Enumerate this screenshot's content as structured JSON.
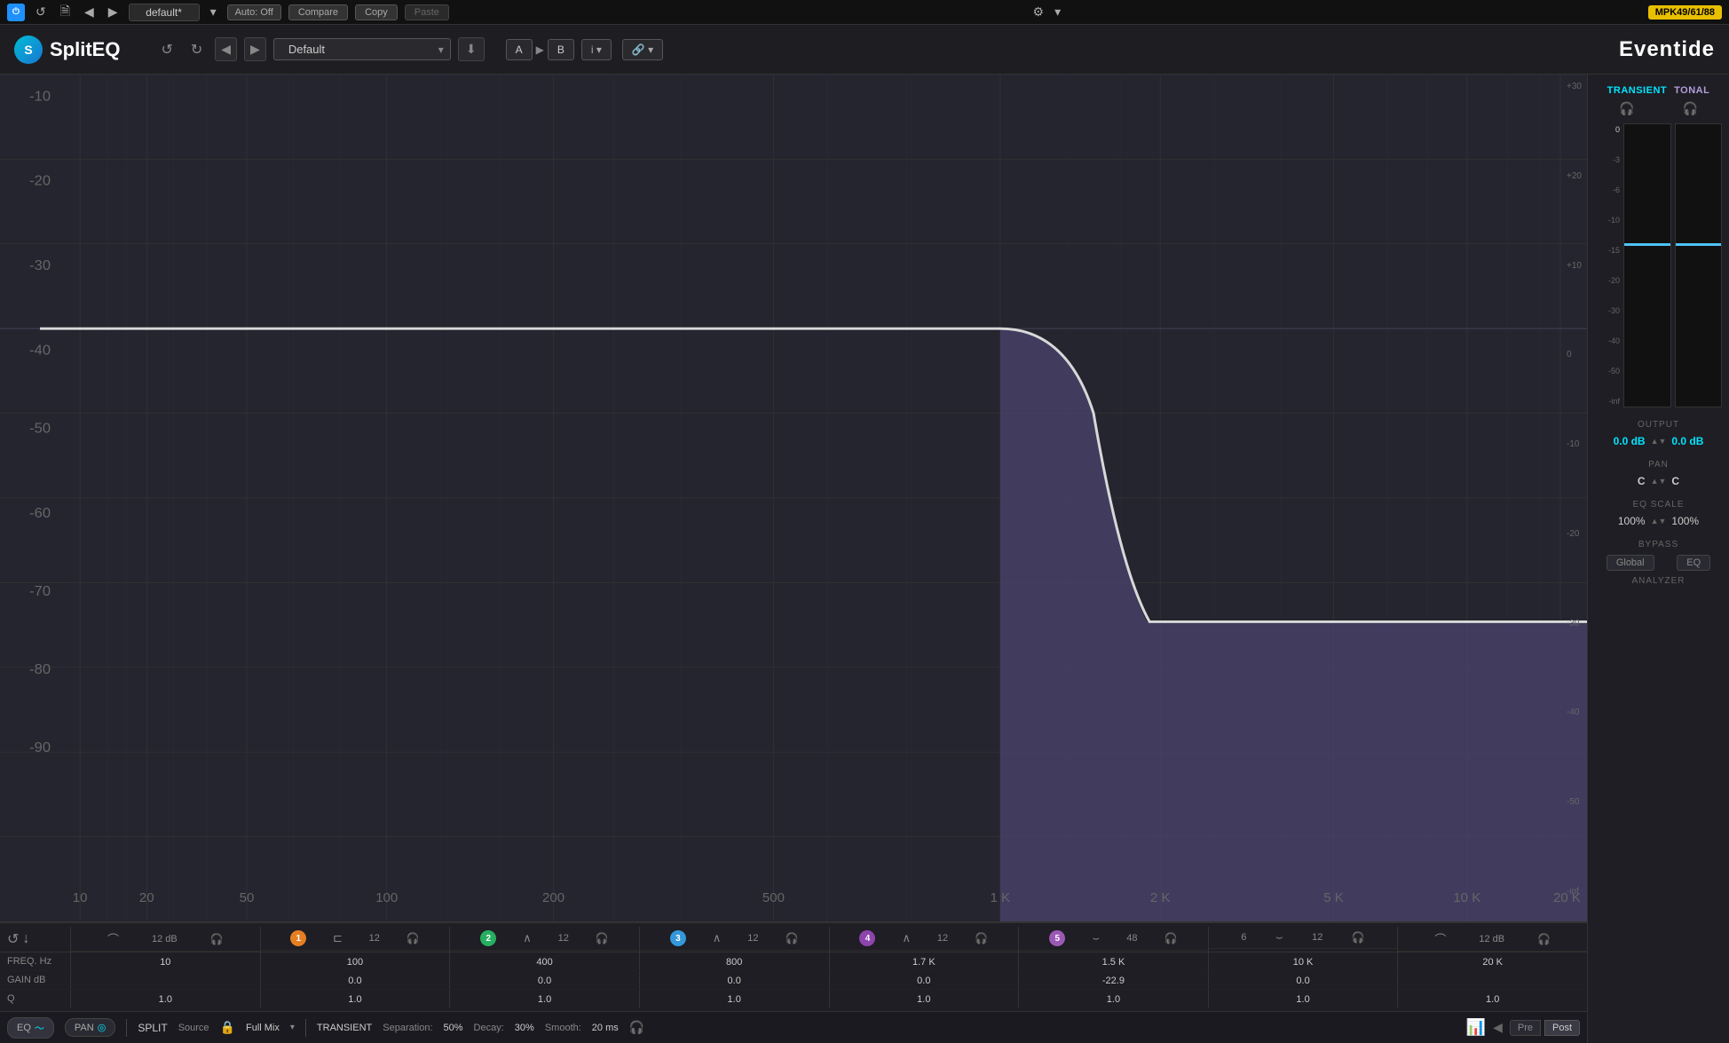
{
  "topbar": {
    "power_label": "⏻",
    "loop_label": "↺",
    "file_label": "🗎",
    "prev_label": "◀",
    "next_label": "▶",
    "preset_name": "default*",
    "dropdown_label": "▾",
    "auto_label": "Auto: Off",
    "compare_label": "Compare",
    "copy_label": "Copy",
    "paste_label": "Paste",
    "gear_label": "⚙",
    "arrow_label": "▾",
    "mpk_label": "MPK49/61/88"
  },
  "header": {
    "logo_letter": "S",
    "logo_text": "SplitEQ",
    "undo_label": "↺",
    "redo_label": "↻",
    "nav_prev": "◀",
    "nav_next": "▶",
    "preset_dropdown": "Default",
    "dropdown_arrow": "▾",
    "save_label": "⬇",
    "ab_a": "A",
    "ab_arrow": "▶",
    "ab_b": "B",
    "info_label": "i ▾",
    "link_label": "🔗 ▾",
    "eventide_label": "Eventide"
  },
  "y_axis_left": [
    "-10",
    "-20",
    "-30",
    "-40",
    "-50",
    "-60",
    "-70",
    "-80",
    "-90"
  ],
  "y_axis_right": [
    "+30",
    "+20",
    "+10",
    "0",
    "-10",
    "-20",
    "-30",
    "-40",
    "-50",
    "-inf"
  ],
  "x_axis": [
    "10",
    "20",
    "50",
    "100",
    "200",
    "500",
    "1 K",
    "2 K",
    "5 K",
    "10 K",
    "20 K"
  ],
  "right_panel": {
    "transient_label": "TRANSIENT",
    "tonal_label": "TONAL",
    "db_scale": [
      "0",
      "-3",
      "-6",
      "-10",
      "-15",
      "-20",
      "-30",
      "-40",
      "-50",
      "-inf"
    ],
    "output_label": "OUTPUT",
    "output_link": "⊘",
    "output_left": "0.0 dB",
    "output_right": "0.0 dB",
    "output_arrow_up": "▲",
    "output_arrow_down": "▼",
    "pan_label": "PAN",
    "pan_left": "C",
    "pan_right": "C",
    "pan_arrow": "▲▼",
    "eq_scale_label": "EQ SCALE",
    "eq_scale_left": "100%",
    "eq_scale_right": "100%",
    "eq_scale_arrow": "▲▼",
    "bypass_label": "BYPASS",
    "bypass_global": "Global",
    "bypass_eq": "EQ",
    "analyzer_label": "ANALYZER"
  },
  "band_controls": {
    "reset_icon": "↺",
    "down_icon": "↓",
    "bands": [
      {
        "id": 0,
        "shape_icon": "⌒",
        "db_label": "12 dB",
        "headphone_icon": "🎧",
        "freq": "10",
        "gain": "",
        "q": "1.0",
        "color": "",
        "has_circle": false,
        "circle_class": ""
      },
      {
        "id": 1,
        "number": "1",
        "shape_icon": "⊏",
        "db_label": "12",
        "headphone_icon": "🎧",
        "freq": "100",
        "gain": "0.0",
        "q": "1.0",
        "color": "#e67e22",
        "has_circle": true,
        "circle_class": "circle-1"
      },
      {
        "id": 2,
        "number": "2",
        "shape_icon": "∧",
        "db_label": "12",
        "headphone_icon": "🎧",
        "freq": "400",
        "gain": "0.0",
        "q": "1.0",
        "color": "#27ae60",
        "has_circle": true,
        "circle_class": "circle-2"
      },
      {
        "id": 3,
        "number": "3",
        "shape_icon": "∧",
        "db_label": "12",
        "headphone_icon": "🎧",
        "freq": "800",
        "gain": "0.0",
        "q": "1.0",
        "color": "#3498db",
        "has_circle": true,
        "circle_class": "circle-3"
      },
      {
        "id": 4,
        "number": "4",
        "shape_icon": "∧",
        "db_label": "12",
        "headphone_icon": "🎧",
        "freq": "1.7 K",
        "gain": "0.0",
        "q": "1.0",
        "color": "#8e44ad",
        "has_circle": true,
        "circle_class": "circle-4"
      },
      {
        "id": 5,
        "number": "5",
        "shape_icon": "⌣",
        "db_label": "48",
        "headphone_icon": "🎧",
        "freq": "1.5 K",
        "gain": "-22.9",
        "q": "1.0",
        "color": "#9b59b6",
        "has_circle": true,
        "circle_class": "circle-5"
      },
      {
        "id": 6,
        "number": "6",
        "shape_icon": "⌣",
        "db_label": "12",
        "headphone_icon": "🎧",
        "freq": "10 K",
        "gain": "0.0",
        "q": "1.0",
        "color": "#555",
        "has_circle": false,
        "circle_class": "circle-6"
      },
      {
        "id": 7,
        "shape_icon": "⌒",
        "db_label": "12 dB",
        "headphone_icon": "🎧",
        "freq": "20 K",
        "gain": "",
        "q": "1.0",
        "color": "",
        "has_circle": false,
        "circle_class": ""
      }
    ]
  },
  "bottom_bar": {
    "eq_label": "EQ",
    "eq_icon": "〜",
    "pan_label": "PAN",
    "pan_icon": "◎",
    "split_label": "SPLIT",
    "source_label": "Source",
    "lock_icon": "🔒",
    "full_mix_label": "Full Mix",
    "arrow_label": "▾",
    "transient_label": "TRANSIENT",
    "separation_label": "Separation:",
    "separation_value": "50%",
    "decay_label": "Decay:",
    "decay_value": "30%",
    "smooth_label": "Smooth:",
    "smooth_value": "20 ms",
    "headphone_icon": "🎧",
    "waveform_icon": "📊",
    "pre_label": "Pre",
    "post_label": "Post"
  }
}
